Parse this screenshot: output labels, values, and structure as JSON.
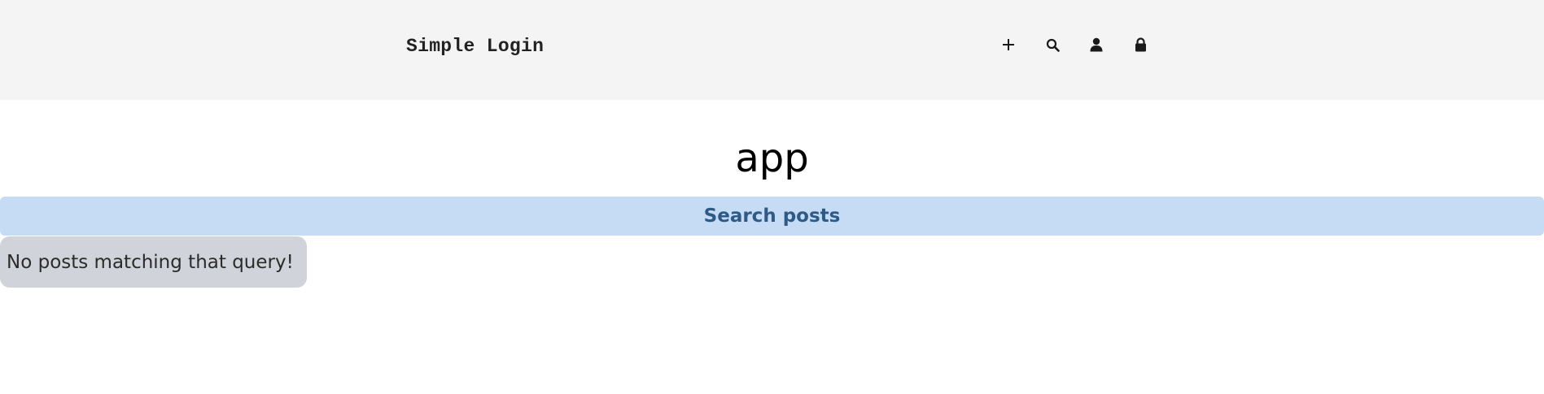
{
  "header": {
    "brand": "Simple Login",
    "nav": [
      {
        "icon": "plus-icon"
      },
      {
        "icon": "search-icon"
      },
      {
        "icon": "user-icon"
      },
      {
        "icon": "lock-icon"
      }
    ]
  },
  "main": {
    "title": "app",
    "search_label": "Search posts",
    "empty_message": "No posts matching that query!"
  },
  "colors": {
    "header_bg": "#f4f4f4",
    "banner_bg": "#c5dcf4",
    "banner_text": "#2e5a87",
    "message_bg": "#d0d3da"
  }
}
